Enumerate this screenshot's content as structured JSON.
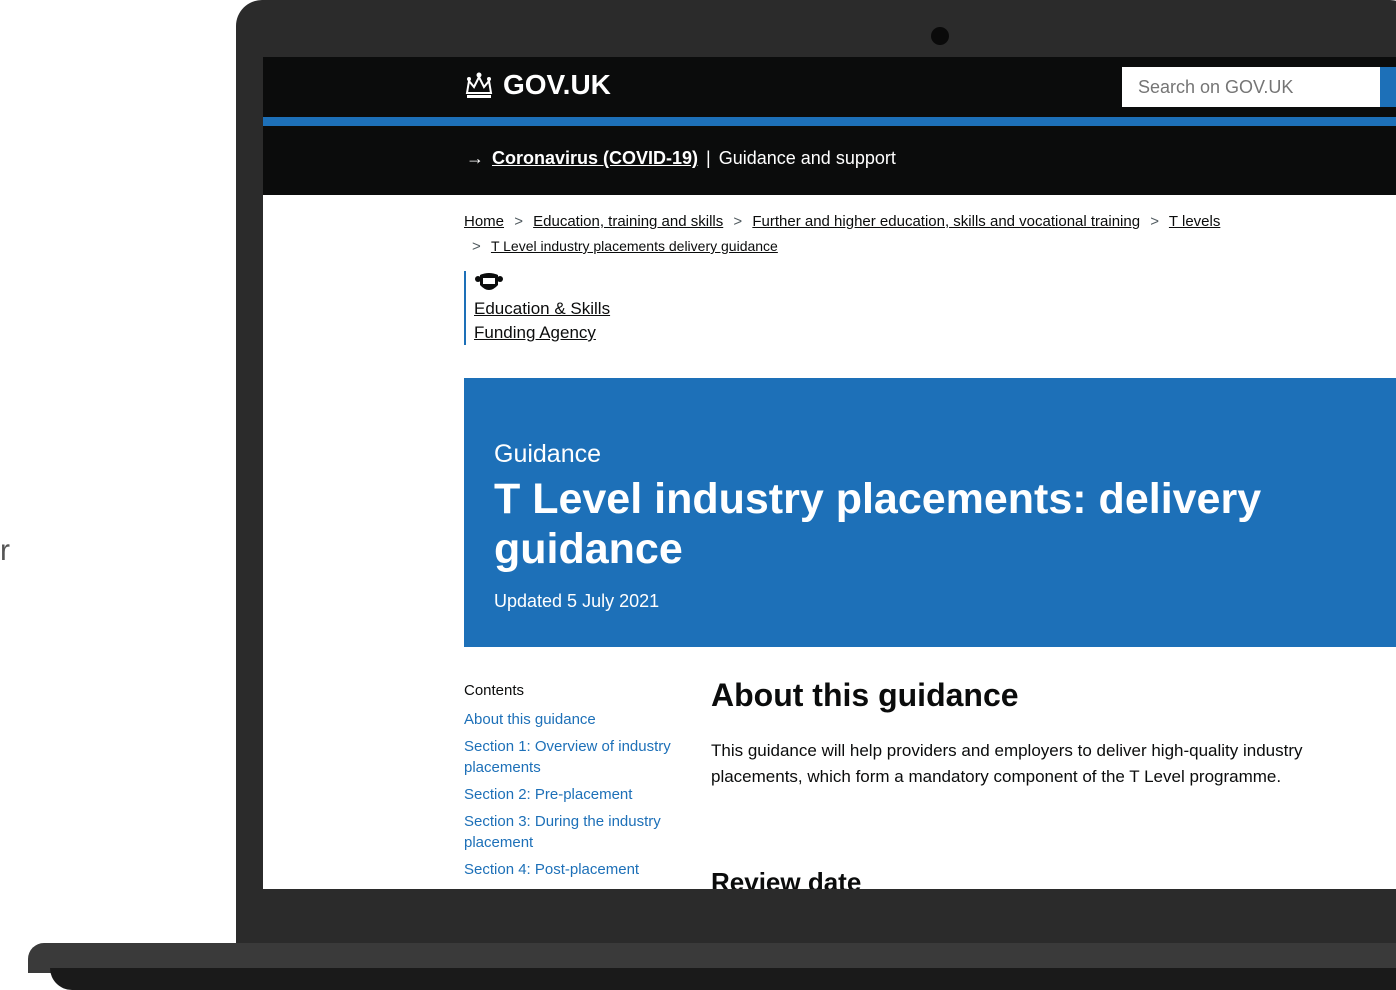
{
  "side_text": "r",
  "header": {
    "logo_text": "GOV.UK",
    "search_placeholder": "Search on GOV.UK"
  },
  "covid_banner": {
    "arrow": "→",
    "link_text": "Coronavirus (COVID-19)",
    "divider": "|",
    "text": "Guidance and support"
  },
  "breadcrumb": {
    "items": [
      "Home",
      "Education, training and skills",
      "Further and higher education, skills and vocational training",
      "T levels",
      "T Level industry placements delivery guidance"
    ],
    "separator": ">"
  },
  "organisation": {
    "line1": "Education & Skills",
    "line2": "Funding Agency"
  },
  "title_band": {
    "doc_type": "Guidance",
    "title": "T Level industry placements: delivery guidance",
    "updated": "Updated 5 July 2021"
  },
  "contents": {
    "heading": "Contents",
    "items": [
      "About this guidance",
      "Section 1: Overview of industry placements",
      "Section 2: Pre-placement",
      "Section 3: During the industry placement",
      "Section 4: Post-placement"
    ]
  },
  "main": {
    "heading": "About this guidance",
    "paragraph": "This guidance will help providers and employers to deliver high-quality industry placements, which form a mandatory component of the T Level programme.",
    "review_heading": "Review date"
  },
  "colors": {
    "govuk_black": "#0b0c0c",
    "govuk_blue": "#1d70b8",
    "laptop_body": "#2b2b2b"
  }
}
